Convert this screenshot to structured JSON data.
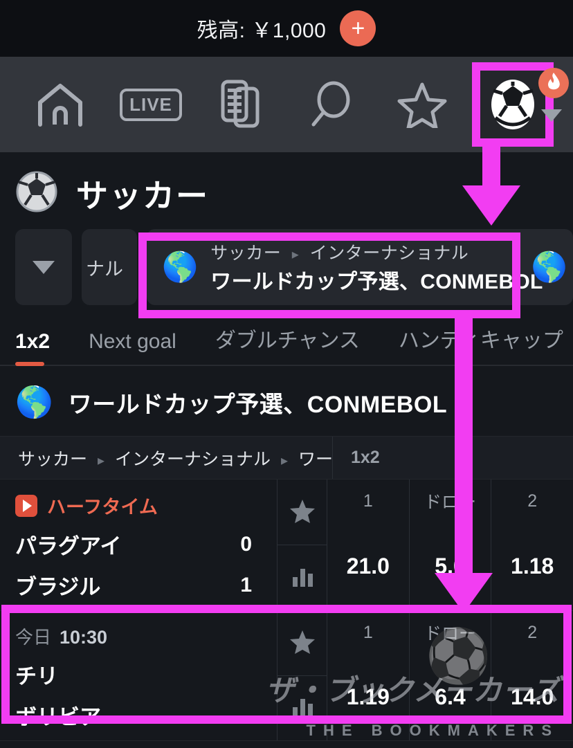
{
  "balance": {
    "label": "残高: ￥1,000",
    "add_button": "+",
    "add_icon": "plus-icon"
  },
  "nav": {
    "items": [
      {
        "name": "home",
        "icon": "home-icon",
        "label": ""
      },
      {
        "name": "live",
        "icon": "live-icon",
        "label": "LIVE"
      },
      {
        "name": "bet-slip",
        "icon": "document-icon",
        "label": ""
      },
      {
        "name": "search",
        "icon": "search-icon",
        "label": ""
      },
      {
        "name": "favorites",
        "icon": "star-icon",
        "label": ""
      },
      {
        "name": "soccer",
        "icon": "soccer-ball-icon",
        "label": "",
        "selected": true
      }
    ],
    "badge_icon": "flame-icon",
    "caret_icon": "chevron-down-icon"
  },
  "page": {
    "title": "サッカー",
    "title_icon": "soccer-ball-icon"
  },
  "chips": {
    "filter_icon": "chevron-down-icon",
    "partial_label": "ナル",
    "selected": {
      "globe_icon": "globe-americas-icon",
      "breadcrumb_root": "サッカー",
      "breadcrumb_sep": "▸",
      "breadcrumb_leaf": "インターナショナル",
      "title": "ワールドカップ予選、CONMEBOL"
    },
    "edge_globe_icon": "globe-americas-icon"
  },
  "tabs": [
    {
      "label": "1x2",
      "active": true
    },
    {
      "label": "Next goal",
      "active": false
    },
    {
      "label": "ダブルチャンス",
      "active": false
    },
    {
      "label": "ハンディキャップ",
      "active": false
    }
  ],
  "league_header": {
    "globe_icon": "globe-americas-icon",
    "name": "ワールドカップ予選、CONMEBOL"
  },
  "table": {
    "breadcrumb": {
      "part1": "サッカー",
      "sep": "▸",
      "part2": "インターナショナル",
      "part3": "ワール..."
    },
    "market_label": "1x2",
    "column_headers": [
      "1",
      "ドロー",
      "2"
    ],
    "favorite_icon": "star-icon",
    "stats_icon": "bar-chart-icon",
    "matches": [
      {
        "status_type": "live",
        "status_icon": "play-icon",
        "status_label": "ハーフタイム",
        "home_team": "パラグアイ",
        "home_score": "0",
        "away_team": "ブラジル",
        "away_score": "1",
        "odds": [
          "21.0",
          "5.0",
          "1.18"
        ],
        "highlighted": false
      },
      {
        "status_type": "scheduled",
        "status_day": "今日",
        "status_time": "10:30",
        "home_team": "チリ",
        "home_score": "",
        "away_team": "ボリビア",
        "away_score": "",
        "odds": [
          "1.19",
          "6.4",
          "14.0"
        ],
        "highlighted": true
      }
    ]
  },
  "watermark": {
    "ball_icon": "flaming-soccer-ball-icon",
    "brand": "ザ・ブックメーカーズ",
    "tagline": "THE BOOKMAKERS"
  },
  "annotations": {
    "accent_color": "#f23df2",
    "boxes": [
      "nav-soccer-tab",
      "league-chip",
      "match-row-chile-bolivia"
    ],
    "arrows": [
      "arrow-to-league-chip",
      "arrow-to-match-row"
    ]
  },
  "colors": {
    "accent_magenta": "#f23df2",
    "brand_orange": "#eb6a54",
    "live_red": "#ef6a52",
    "nav_bg": "#33363c",
    "page_bg": "#15181d",
    "top_bg": "#0d0f13"
  }
}
